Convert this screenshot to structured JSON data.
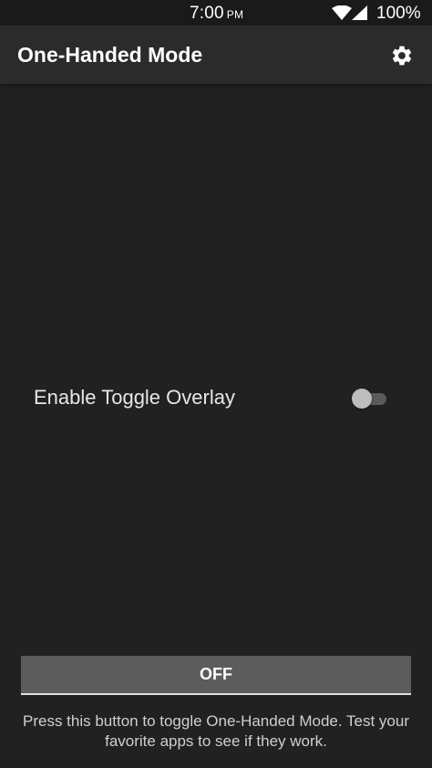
{
  "status_bar": {
    "time": "7:00",
    "am_pm": "PM",
    "wifi_icon": "wifi-icon",
    "signal_icon": "cell-signal-icon",
    "battery": "100%"
  },
  "app_bar": {
    "title": "One-Handed Mode",
    "settings_icon": "gear-icon"
  },
  "overlay_setting": {
    "label": "Enable Toggle Overlay",
    "enabled": false
  },
  "mode_button": {
    "label": "OFF"
  },
  "help_text": "Press this button to toggle One-Handed Mode. Test your favorite apps to see if they work.",
  "colors": {
    "background": "#212121",
    "app_bar": "#2b2b2b",
    "button": "#5c5c5c",
    "text": "#ffffff"
  }
}
